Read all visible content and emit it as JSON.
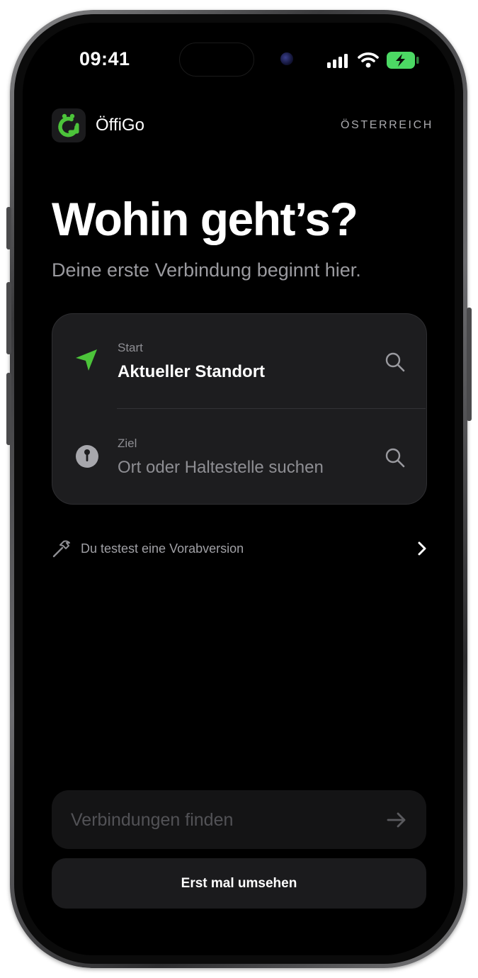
{
  "status_bar": {
    "time": "09:41"
  },
  "header": {
    "app_name": "ÖffiGo",
    "region": "ÖSTERREICH"
  },
  "hero": {
    "title": "Wohin geht’s?",
    "subtitle": "Deine erste Verbindung beginnt hier."
  },
  "search": {
    "start_label": "Start",
    "start_value": "Aktueller Standort",
    "destination_label": "Ziel",
    "destination_placeholder": "Ort oder Haltestelle suchen"
  },
  "beta_notice": {
    "text": "Du testest eine Vorabversion"
  },
  "actions": {
    "find_connections": "Verbindungen finden",
    "browse": "Erst mal umsehen"
  },
  "colors": {
    "accent": "#4cc43a",
    "background": "#000000",
    "card": "#1d1d1f",
    "battery": "#4cd964"
  },
  "icons": [
    "location-arrow-icon",
    "pin-icon",
    "search-icon",
    "hammer-icon",
    "chevron-right-icon",
    "arrow-right-icon",
    "signal-icon",
    "wifi-icon",
    "battery-icon"
  ]
}
